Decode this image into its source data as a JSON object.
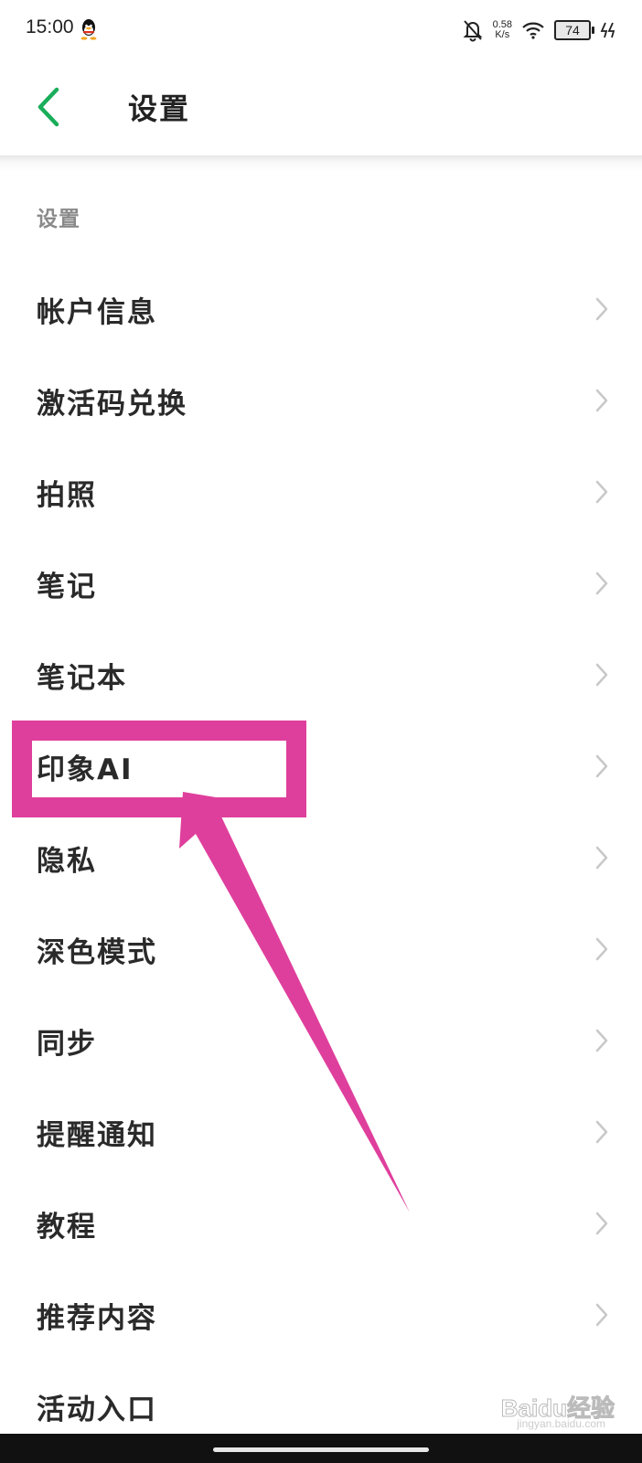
{
  "status_bar": {
    "time": "15:00",
    "net_speed": "0.58",
    "net_unit": "K/s",
    "battery": "74",
    "icons": [
      "qq-icon",
      "bell-off-icon",
      "wifi-icon",
      "battery-icon",
      "charging-icon"
    ]
  },
  "header": {
    "title": "设置",
    "back_icon": "chevron-left-icon",
    "accent_color": "#1aad5a"
  },
  "section": {
    "label": "设置"
  },
  "settings_items": [
    {
      "label": "帐户信息"
    },
    {
      "label": "激活码兑换"
    },
    {
      "label": "拍照"
    },
    {
      "label": "笔记"
    },
    {
      "label": "笔记本"
    },
    {
      "label": "印象AI"
    },
    {
      "label": "隐私"
    },
    {
      "label": "深色模式"
    },
    {
      "label": "同步"
    },
    {
      "label": "提醒通知"
    },
    {
      "label": "教程"
    },
    {
      "label": "推荐内容"
    },
    {
      "label": "活动入口"
    }
  ],
  "annotation": {
    "highlight_color": "#df3f9c",
    "highlighted_item": "印象AI"
  },
  "watermark": {
    "brand": "Baidu经验",
    "url": "jingyan.baidu.com"
  }
}
